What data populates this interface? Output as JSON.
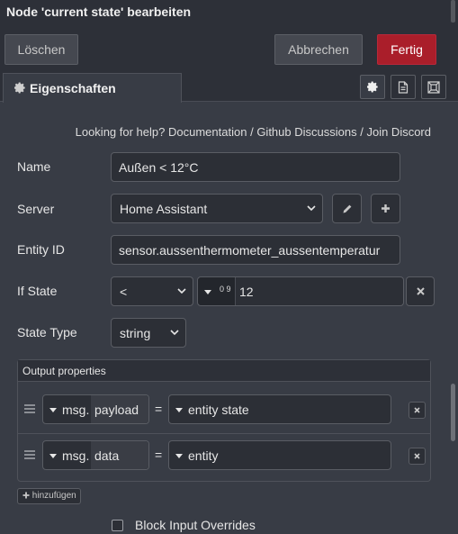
{
  "window": {
    "title": "Node 'current state' bearbeiten"
  },
  "actions": {
    "delete_label": "Löschen",
    "cancel_label": "Abbrechen",
    "done_label": "Fertig"
  },
  "tabs": {
    "properties_label": "Eigenschaften",
    "icons": [
      "gear-icon",
      "document-icon",
      "frame-icon"
    ]
  },
  "help": {
    "prefix": "Looking for help?",
    "documentation": "Documentation",
    "sep": "/",
    "github": "Github Discussions",
    "discord": "Join Discord"
  },
  "form": {
    "name": {
      "label": "Name",
      "value": "Außen < 12°C"
    },
    "server": {
      "label": "Server",
      "value": "Home Assistant"
    },
    "entity_id": {
      "label": "Entity ID",
      "value": "sensor.aussenthermometer_aussentemperatur"
    },
    "if_state": {
      "label": "If State",
      "operator": "<",
      "type_glyph": "0 9",
      "value": "12"
    },
    "state_type": {
      "label": "State Type",
      "value": "string"
    }
  },
  "output": {
    "title": "Output properties",
    "rows": [
      {
        "prefix": "msg.",
        "property": "payload",
        "equals": "=",
        "value": "entity state"
      },
      {
        "prefix": "msg.",
        "property": "data",
        "equals": "=",
        "value": "entity"
      }
    ],
    "add_label": "hinzufügen"
  },
  "options": {
    "block_input_overrides": "Block Input Overrides"
  },
  "colors": {
    "background": "#383c45",
    "header": "#2d3038",
    "primary": "#aa1e2a",
    "input": "#2c2f36"
  }
}
